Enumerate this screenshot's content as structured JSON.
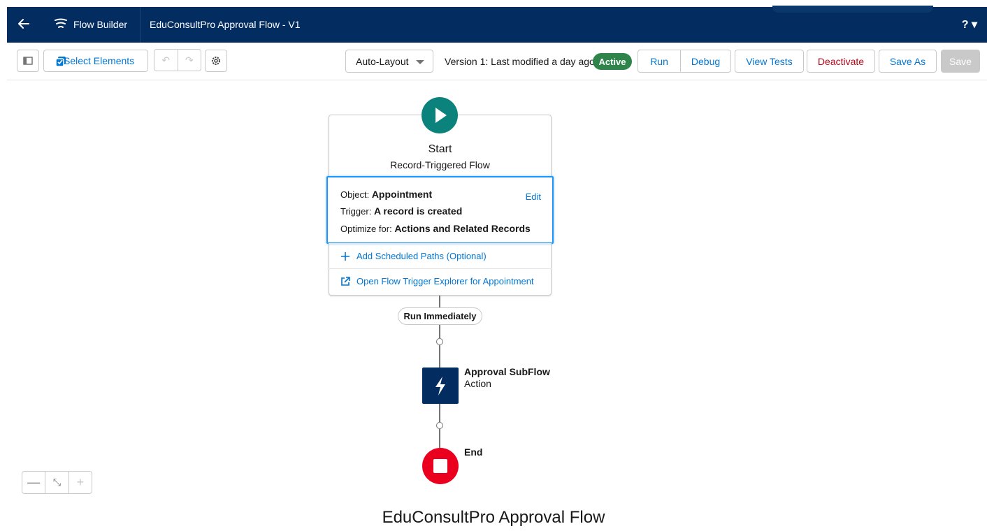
{
  "header": {
    "app_name": "Flow Builder",
    "flow_title": "EduConsultPro Approval Flow - V1",
    "help_label": "? ▾",
    "back_icon": "arrow-left-icon",
    "app_icon": "flow-icon",
    "background": "#032d60"
  },
  "toolbar": {
    "select_elements_label": "Select Elements",
    "layout_select_value": "Auto-Layout",
    "version_text": "Version 1: Last modified a day ago",
    "status_badge": "Active",
    "run_label": "Run",
    "debug_label": "Debug",
    "view_tests_label": "View Tests",
    "deactivate_label": "Deactivate",
    "save_as_label": "Save As",
    "save_label": "Save",
    "accent": "#0176d3"
  },
  "start_node": {
    "title": "Start",
    "subtitle": "Record-Triggered Flow",
    "object_label": "Object:",
    "object_value": "Appointment",
    "trigger_label": "Trigger:",
    "trigger_value": "A record is created",
    "optimize_label": "Optimize for:",
    "optimize_value": "Actions and Related Records",
    "edit_label": "Edit",
    "add_scheduled_label": "Add Scheduled Paths (Optional)",
    "open_explorer_label": "Open Flow Trigger Explorer for Appointment",
    "color": "#0b827c"
  },
  "path_label": "Run Immediately",
  "action_node": {
    "title": "Approval SubFlow",
    "type": "Action",
    "icon": "lightning-icon"
  },
  "end_node": {
    "title": "End",
    "color": "#ea001e"
  },
  "zoom": {
    "zoom_out": "—",
    "fit": "⤡",
    "zoom_in": "+"
  },
  "caption": "EduConsultPro Approval Flow"
}
